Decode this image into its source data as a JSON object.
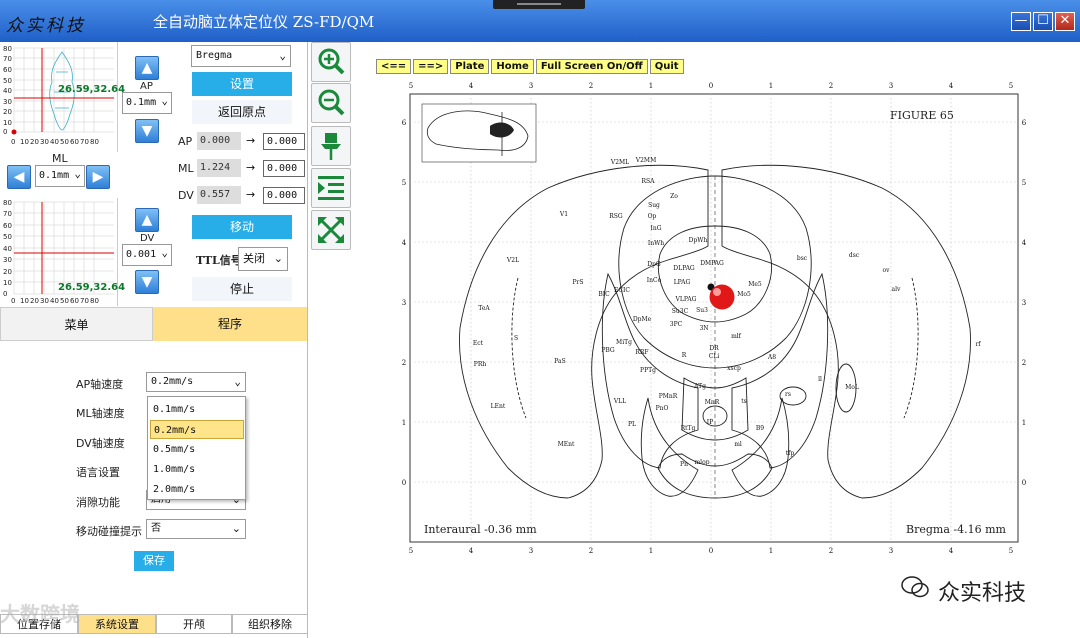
{
  "window": {
    "brand": "众实科技",
    "title": "全自动脑立体定位仪 ZS-FD/QM",
    "minimize_glyph": "—",
    "maximize_glyph": "☐",
    "close_glyph": "✕"
  },
  "plot_top": {
    "coord": "26.59,32.64",
    "axis_label": "ML",
    "x_ticks": [
      "0",
      "10",
      "20",
      "30",
      "40",
      "50",
      "60",
      "70",
      "80"
    ],
    "y_ticks": [
      "80",
      "70",
      "60",
      "50",
      "40",
      "30",
      "20",
      "10",
      "0"
    ]
  },
  "plot_bottom": {
    "coord": "26.59,32.64",
    "x_ticks": [
      "0",
      "10",
      "20",
      "30",
      "40",
      "50",
      "60",
      "70",
      "80"
    ],
    "y_ticks": [
      "80",
      "70",
      "60",
      "50",
      "40",
      "30",
      "20",
      "10",
      "0"
    ]
  },
  "ap_control": {
    "label": "AP",
    "step": "0.1mm"
  },
  "ml_control": {
    "step": "0.1mm"
  },
  "dv_control": {
    "label": "DV",
    "step": "0.001"
  },
  "reference": {
    "selected": "Bregma"
  },
  "buttons": {
    "set": "设置",
    "return_origin": "返回原点",
    "move": "移动",
    "stop": "停止"
  },
  "coords": [
    {
      "axis": "AP",
      "current": "0.000",
      "arrow": "→",
      "target": "0.000"
    },
    {
      "axis": "ML",
      "current": "1.224",
      "arrow": "→",
      "target": "0.000"
    },
    {
      "axis": "DV",
      "current": "0.557",
      "arrow": "→",
      "target": "0.000"
    }
  ],
  "ttl": {
    "label": "TTL信号",
    "value": "关闭"
  },
  "tabs": {
    "menu": "菜单",
    "program": "程序"
  },
  "settings": {
    "ap_speed_label": "AP轴速度",
    "ap_speed_value": "0.2mm/s",
    "ml_speed_label": "ML轴速度",
    "dv_speed_label": "DV轴速度",
    "language_label": "语言设置",
    "backlash_label": "消隙功能",
    "backlash_value": "启用",
    "collision_label": "移动碰撞提示",
    "collision_value": "否",
    "save": "保存"
  },
  "speed_options": [
    "0.1mm/s",
    "0.2mm/s",
    "0.5mm/s",
    "1.0mm/s",
    "2.0mm/s"
  ],
  "speed_selected_index": 1,
  "bottom_buttons": [
    "位置存储",
    "系统设置",
    "开颅",
    "组织移除"
  ],
  "atlas_toolbar": [
    "<==",
    "==>",
    "Plate",
    "Home",
    "Full Screen On/Off",
    "Quit"
  ],
  "atlas": {
    "figure": "FIGURE 65",
    "interaural": "Interaural -0.36 mm",
    "bregma": "Bregma -4.16 mm",
    "top_ticks": [
      "5",
      "4",
      "3",
      "2",
      "1",
      "0",
      "1",
      "2",
      "3",
      "4",
      "5"
    ],
    "left_ticks": [
      "6",
      "5",
      "4",
      "3",
      "2",
      "1",
      "0"
    ],
    "right_ticks": [
      "6",
      "5",
      "4",
      "3",
      "2",
      "1",
      "0"
    ],
    "bottom_ticks": [
      "5",
      "4",
      "3",
      "2",
      "1",
      "0",
      "1",
      "2",
      "3",
      "4",
      "5"
    ],
    "region_labels": [
      "V2ML",
      "V2MM",
      "RSA",
      "Zo",
      "Sug",
      "Op",
      "InG",
      "InWh",
      "DpWh",
      "DpG",
      "DMPAG",
      "DLPAG",
      "LPAG",
      "VLPAG",
      "Su3C",
      "Su3",
      "InCo",
      "ECIC",
      "BIC",
      "PrS",
      "V1",
      "RSG",
      "V2L",
      "TeA",
      "S",
      "PaS",
      "Ect",
      "PRh",
      "LEnt",
      "MEnt",
      "DpMe",
      "3PC",
      "3N",
      "mlf",
      "MiTg",
      "PBG",
      "RRF",
      "PPTg",
      "DR",
      "CLi",
      "R",
      "ATg",
      "PMnR",
      "MnR",
      "VLL",
      "PnO",
      "PL",
      "RtTg",
      "IP",
      "B9",
      "mlop",
      "Pn",
      "tfp",
      "xscp",
      "A8",
      "ll",
      "rs",
      "Mo5",
      "bsc",
      "dsc",
      "ov",
      "alv",
      "rf",
      "MoL",
      "Me5",
      "ts",
      "ml"
    ]
  },
  "watermark": {
    "left": "大数跨境",
    "right": "众实科技"
  }
}
